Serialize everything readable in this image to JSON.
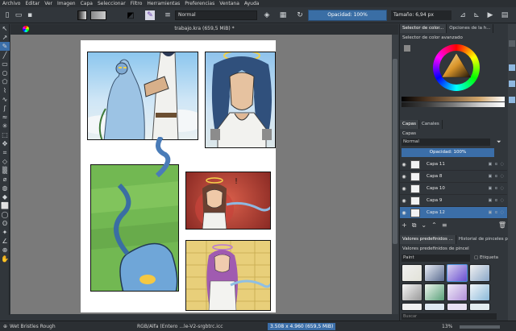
{
  "menu": [
    "Archivo",
    "Editar",
    "Ver",
    "Imagen",
    "Capa",
    "Seleccionar",
    "Filtro",
    "Herramientas",
    "Preferencias",
    "Ventana",
    "Ayuda"
  ],
  "toolbar": {
    "blend_mode": "Normal",
    "opacity": "Opacidad: 100%",
    "size": "Tamaño: 6,94 px"
  },
  "document": {
    "title": "trabajo.kra (659,5 MiB) *"
  },
  "dock": {
    "color_tabs": [
      "Selector de color...",
      "Opciones de la h...",
      "..."
    ],
    "color_selector_title": "Selector de color avanzado",
    "layers_tabs": [
      "Capas",
      "Canales"
    ],
    "layers_title": "Capas",
    "layers_blend": "Normal",
    "layers_opacity": "Opacidad: 100%",
    "layers": [
      {
        "name": "Capa 11",
        "selected": false
      },
      {
        "name": "Capa 8",
        "selected": false
      },
      {
        "name": "Capa 10",
        "selected": false
      },
      {
        "name": "Capa 9",
        "selected": false
      },
      {
        "name": "Capa 12",
        "selected": true
      }
    ],
    "presets_tabs": [
      "Valores predefinidos ...",
      "Historial de pinceles pre..."
    ],
    "presets_title": "Valores predefinidos de pincel",
    "presets_filter": "Paint",
    "presets_tag": "Etiqueta",
    "search_placeholder": "Buscar"
  },
  "status": {
    "brush": "Wet Bristles Rough",
    "color_profile": "RGB/Alfa (Entero ...le-V2-srgbtrc.icc",
    "dimensions": "3.508 x 4.960 (659,5 MiB)",
    "zoom": "13%"
  },
  "colors": {
    "accent": "#3b6ea8",
    "bg": "#31363b",
    "canvas_bg": "#7a7a7a"
  }
}
